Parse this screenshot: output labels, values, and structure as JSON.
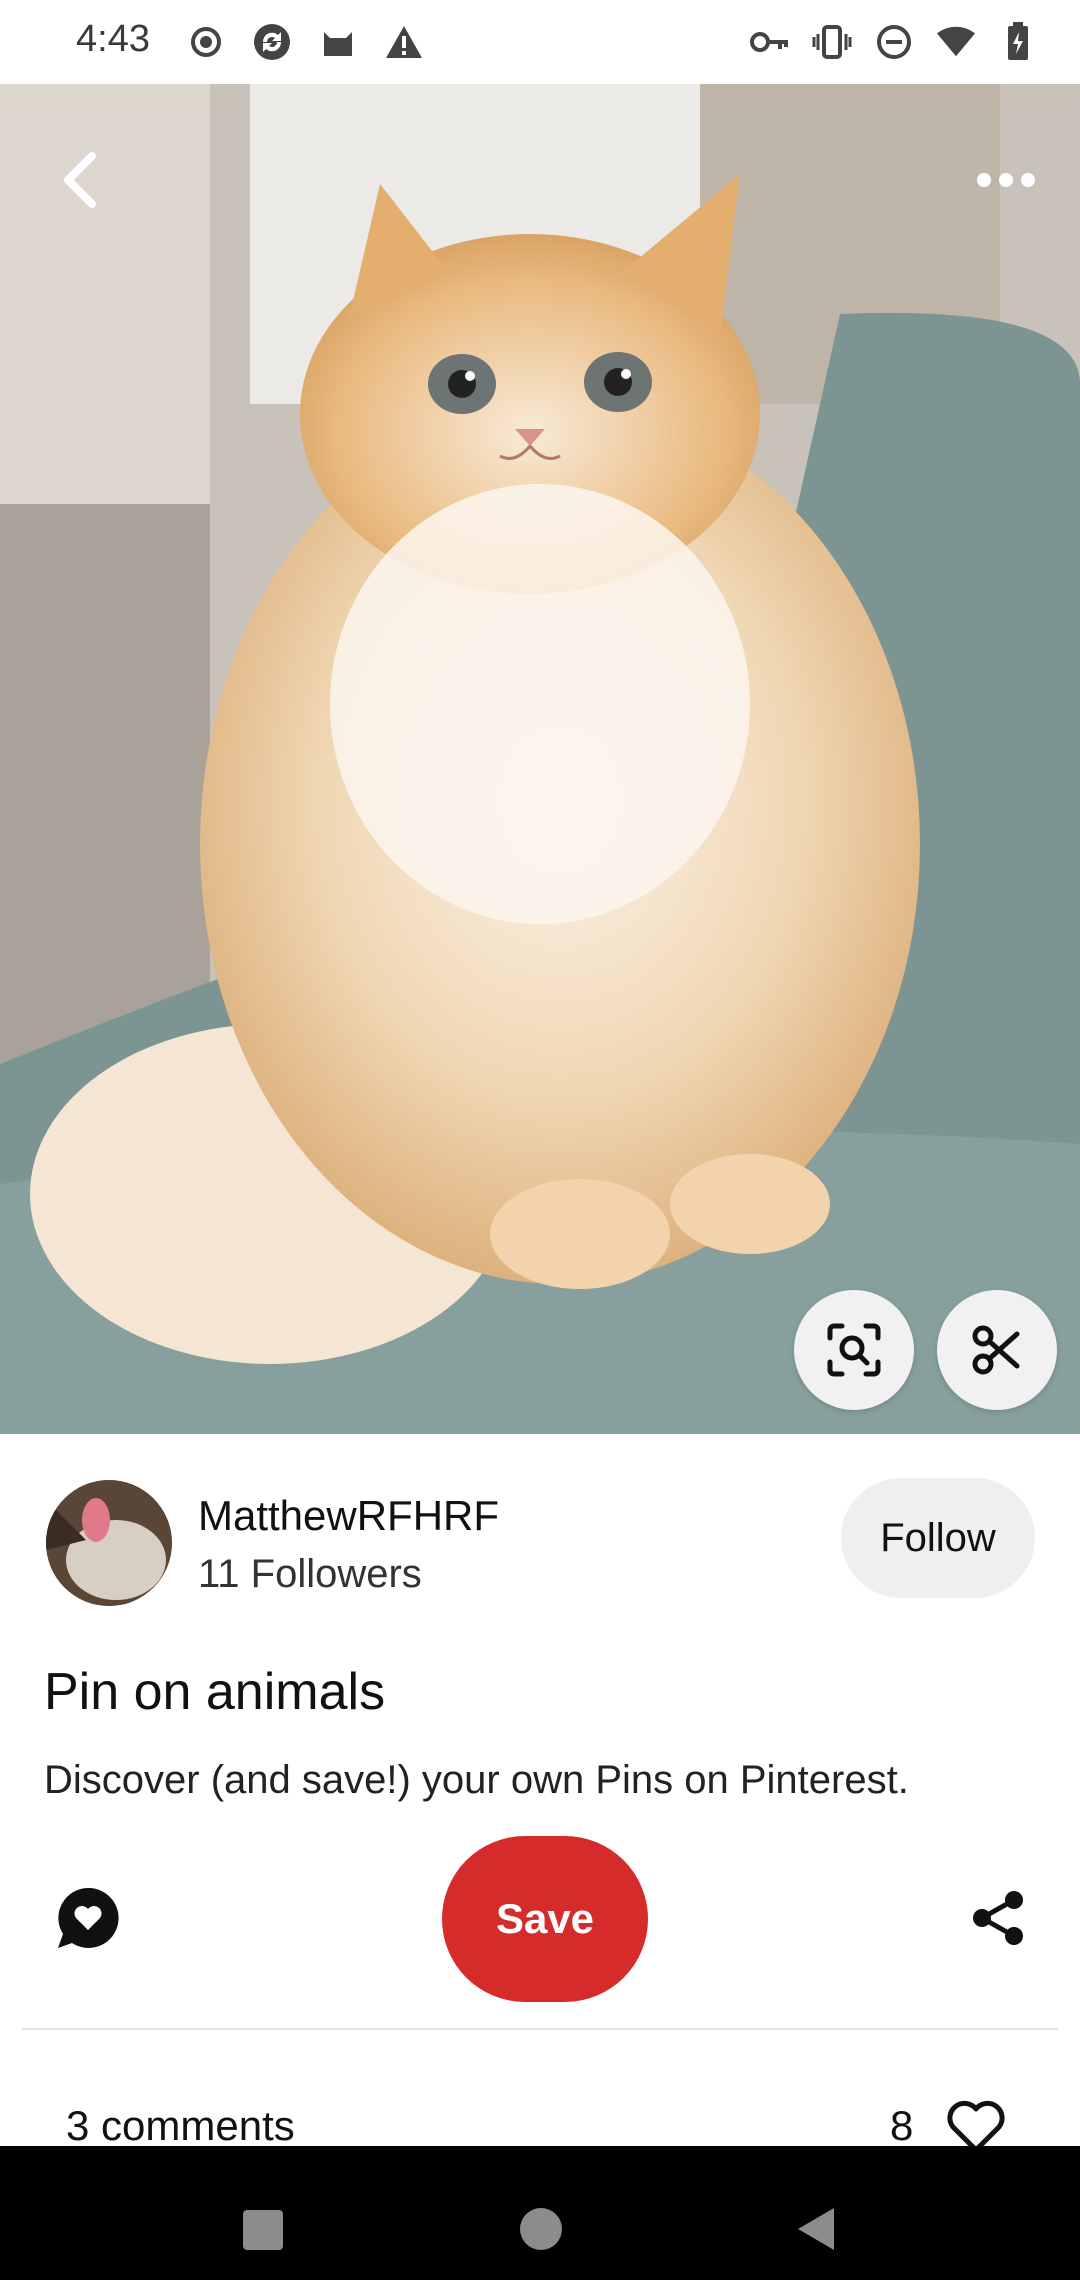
{
  "status_bar": {
    "time": "4:43",
    "left_icons": [
      "radio-icon",
      "sync-icon",
      "cat-icon",
      "warning-icon"
    ],
    "right_icons": [
      "key-icon",
      "vibrate-icon",
      "dnd-icon",
      "wifi-icon",
      "battery-icon"
    ]
  },
  "pin": {
    "image": "fluffy-cream-kitten-photo",
    "title": "Pin on animals",
    "description": "Discover (and save!) your own Pins on Pinterest."
  },
  "creator": {
    "name": "MatthewRFHRF",
    "followers": "11 Followers",
    "follow_label": "Follow"
  },
  "actions": {
    "save_label": "Save",
    "save_color": "#d62b2b"
  },
  "comments": {
    "count_label": "3 comments",
    "likes": "8"
  },
  "nav_bar": {
    "buttons": [
      "recents",
      "home",
      "back"
    ]
  }
}
